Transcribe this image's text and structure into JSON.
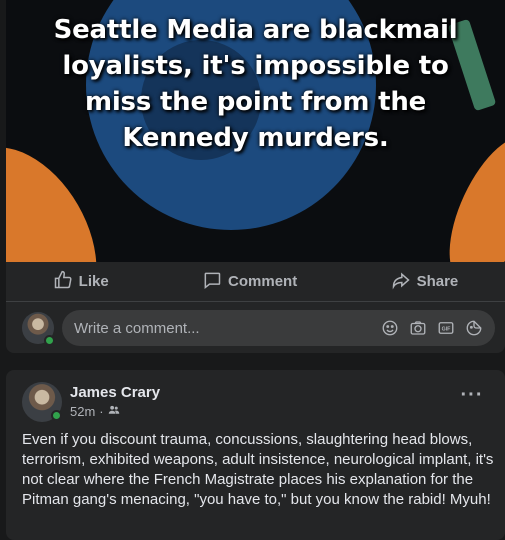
{
  "post1": {
    "image_caption": "Seattle Media are blackmail loyalists, it's impossible to miss the point from the Kennedy murders.",
    "actions": {
      "like": "Like",
      "comment": "Comment",
      "share": "Share"
    },
    "comment_input": {
      "placeholder": "Write a comment..."
    },
    "icons": [
      "like-icon",
      "comment-icon",
      "share-icon",
      "emoji-icon",
      "camera-icon",
      "gif-icon",
      "sticker-icon"
    ]
  },
  "post2": {
    "author": "James Crary",
    "time": "52m",
    "audience_icon": "friends-icon",
    "body": "Even if you discount trauma, concussions, slaughtering head blows, terrorism, exhibited weapons, adult insistence, neurological implant, it's not clear where the French Magistrate places his explanation for the Pitman gang's menacing, \"you have to,\" but you know the rabid! Myuh!",
    "more_label": "···"
  },
  "colors": {
    "background": "#18191a",
    "card": "#242526",
    "input": "#3a3b3c",
    "text_primary": "#e4e6eb",
    "text_secondary": "#b0b3b8",
    "online": "#31a24c",
    "disc_blue": "#1c4a7e",
    "accent_orange": "#d9782b"
  }
}
